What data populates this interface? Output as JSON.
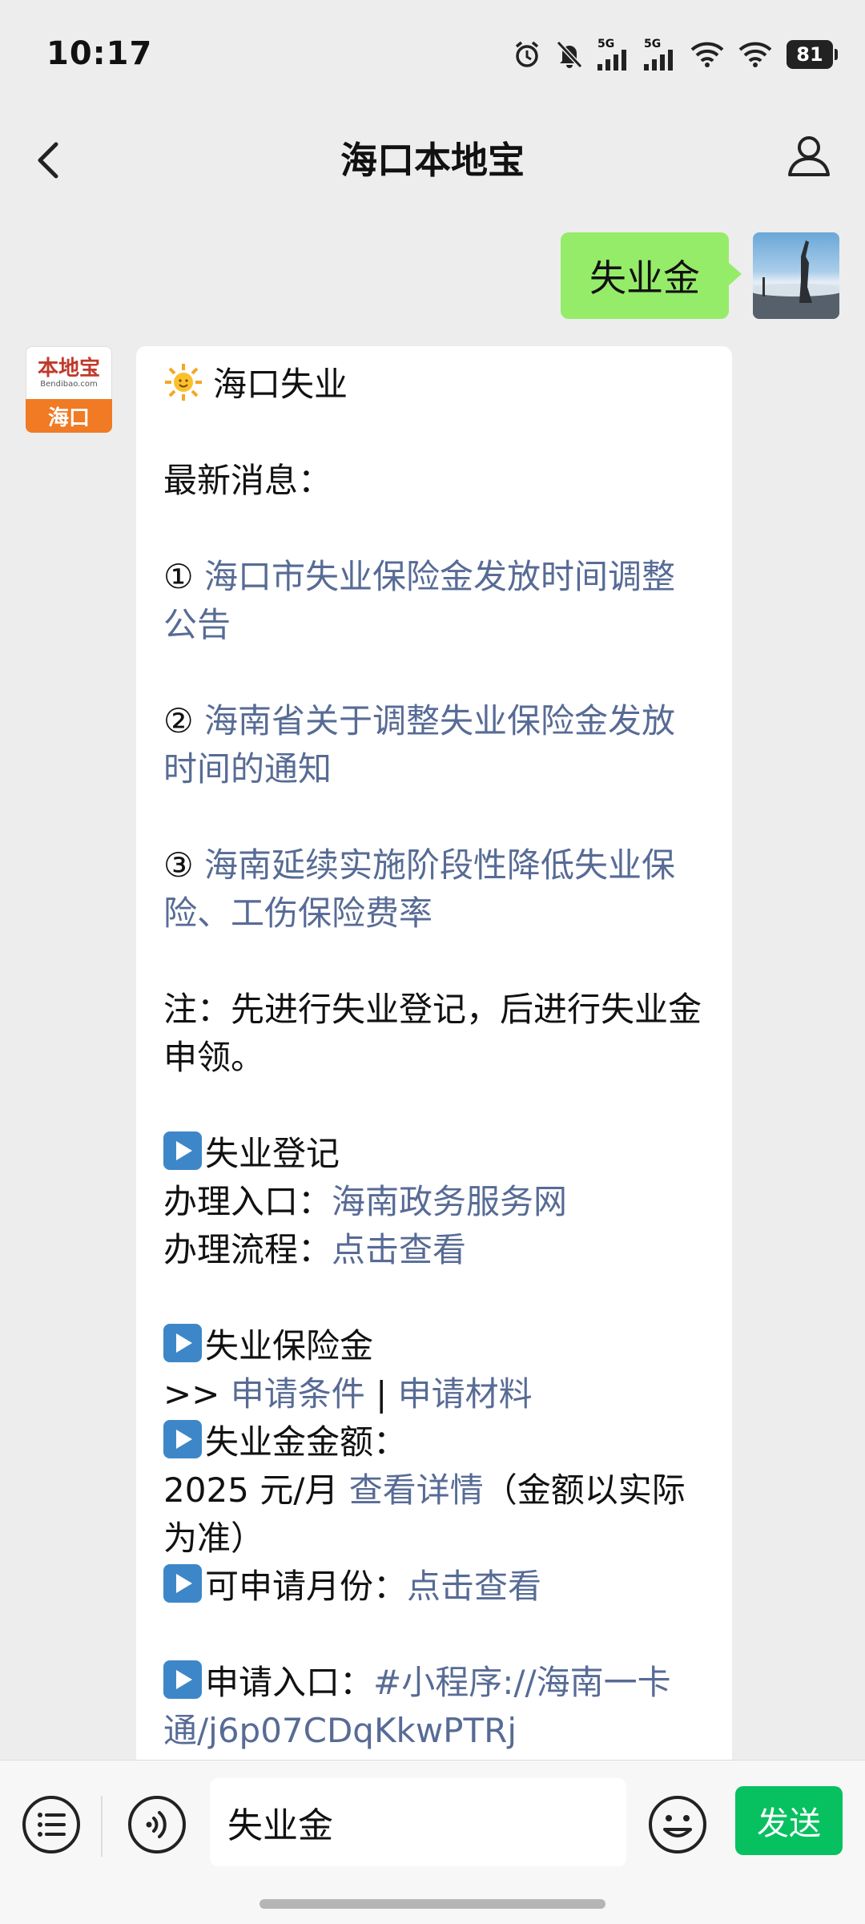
{
  "status": {
    "time": "10:17",
    "battery": "81",
    "signal_1": "5G",
    "signal_2": "5G"
  },
  "nav": {
    "title": "海口本地宝"
  },
  "sent_message": {
    "text": "失业金"
  },
  "bot": {
    "avatar_logo": "本地宝",
    "avatar_sub": "Bendibao.com",
    "avatar_city": "海口"
  },
  "reply": {
    "header": "海口失业",
    "latest_label": "最新消息：",
    "news_1_marker": "①",
    "news_1": "海口市失业保险金发放时间调整公告",
    "news_2_marker": "②",
    "news_2": "海南省关于调整失业保险金发放时间的通知",
    "news_3_marker": "③",
    "news_3": "海南延续实施阶段性降低失业保险、工伤保险费率",
    "note": "注：先进行失业登记，后进行失业金申领。",
    "reg_title": "失业登记",
    "reg_entry_label": "办理入口：",
    "reg_entry_link": "海南政务服务网",
    "reg_flow_label": "办理流程：",
    "reg_flow_link": "点击查看",
    "ins_title": "失业保险金",
    "ins_prefix": ">> ",
    "ins_cond_link": "申请条件",
    "ins_sep": " | ",
    "ins_mat_link": "申请材料",
    "amount_title": "失业金金额：",
    "amount_value": "2025 元/月 ",
    "amount_link": "查看详情",
    "amount_note": "（金额以实际为准）",
    "months_label": "可申请月份：",
    "months_link": "点击查看",
    "apply_label": "申请入口：",
    "apply_link": "#小程序://海南一卡通/j6p07CDqKkwPTRj"
  },
  "input": {
    "text": "失业金",
    "send_label": "发送"
  },
  "colors": {
    "sent_bubble": "#95ec69",
    "link": "#576b95",
    "send_button": "#07c160",
    "play_icon": "#3d87c9"
  }
}
